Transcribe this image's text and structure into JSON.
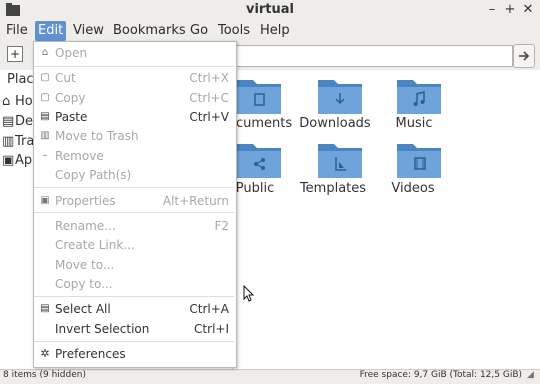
{
  "window": {
    "title": "virtual",
    "minimize": "–",
    "maximize": "+",
    "close": "✕"
  },
  "menubar": [
    "File",
    "Edit",
    "View",
    "Bookmarks",
    "Go",
    "Tools",
    "Help"
  ],
  "sidebar": {
    "heading": "Place",
    "items": [
      "Ho",
      "De",
      "Tra",
      "Ap"
    ]
  },
  "folders": [
    {
      "label": "ocuments",
      "icon": "documents-folder-icon"
    },
    {
      "label": "Downloads",
      "icon": "downloads-folder-icon"
    },
    {
      "label": "Music",
      "icon": "music-folder-icon"
    },
    {
      "label": "Public",
      "icon": "public-folder-icon"
    },
    {
      "label": "Templates",
      "icon": "templates-folder-icon"
    },
    {
      "label": "Videos",
      "icon": "videos-folder-icon"
    }
  ],
  "edit_menu": {
    "open": "Open",
    "cut": "Cut",
    "cut_acc": "Ctrl+X",
    "copy": "Copy",
    "copy_acc": "Ctrl+C",
    "paste": "Paste",
    "paste_acc": "Ctrl+V",
    "move_trash": "Move to Trash",
    "remove": "Remove",
    "copy_paths": "Copy Path(s)",
    "properties": "Properties",
    "properties_acc": "Alt+Return",
    "rename": "Rename...",
    "rename_acc": "F2",
    "create_link": "Create Link...",
    "move_to": "Move to...",
    "copy_to": "Copy to...",
    "select_all": "Select All",
    "select_all_acc": "Ctrl+A",
    "invert": "Invert Selection",
    "invert_acc": "Ctrl+I",
    "preferences": "Preferences"
  },
  "status": {
    "items": "8 items (9 hidden)",
    "free": "Free space: 9,7 GiB (Total: 12,5 GiB)"
  },
  "colors": {
    "accent": "#5f93cf",
    "folder": "#4a86c5",
    "folder_light": "#7fb0df"
  }
}
